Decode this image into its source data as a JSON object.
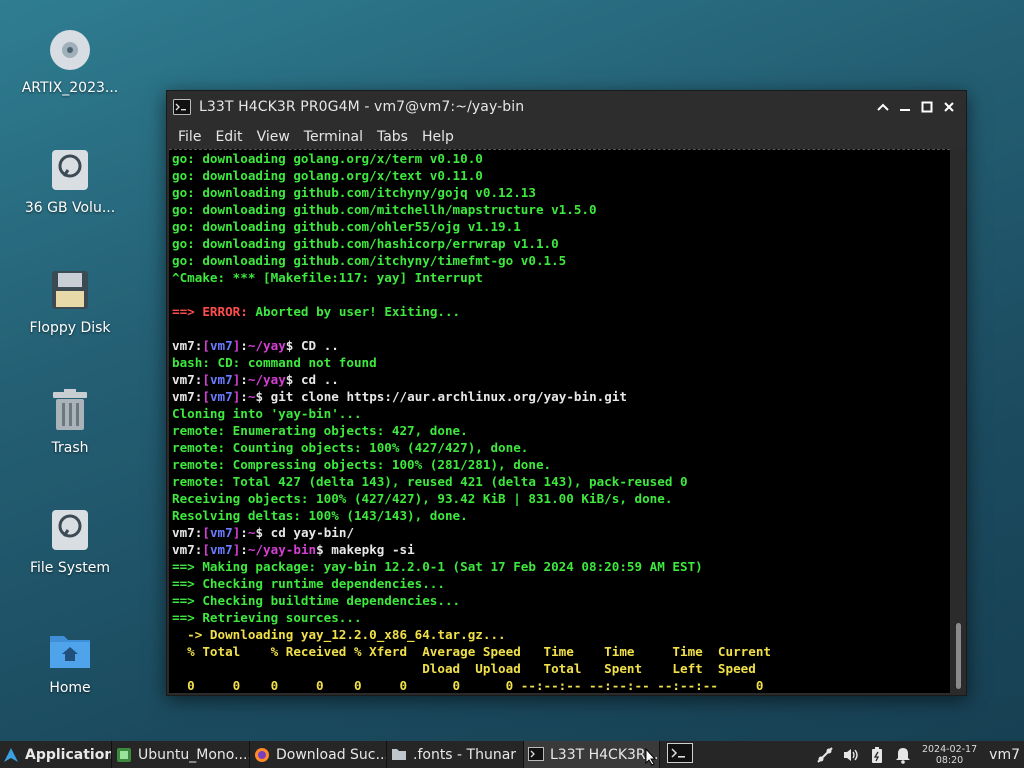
{
  "desktop": {
    "icons": [
      {
        "label": "ARTIX_2023...",
        "icon": "optical-disc-icon"
      },
      {
        "label": "36 GB Volu...",
        "icon": "hard-drive-icon"
      },
      {
        "label": "Floppy Disk",
        "icon": "floppy-disk-icon"
      },
      {
        "label": "Trash",
        "icon": "trash-icon"
      },
      {
        "label": "File System",
        "icon": "hard-drive-icon"
      },
      {
        "label": "Home",
        "icon": "home-folder-icon"
      }
    ]
  },
  "terminal": {
    "title": "L33T H4CK3R PR0G4M - vm7@vm7:~/yay-bin",
    "menu": [
      "File",
      "Edit",
      "View",
      "Terminal",
      "Tabs",
      "Help"
    ],
    "lines": {
      "l0": "go: downloading golang.org/x/term v0.10.0",
      "l1": "go: downloading golang.org/x/text v0.11.0",
      "l2": "go: downloading github.com/itchyny/gojq v0.12.13",
      "l3": "go: downloading github.com/mitchellh/mapstructure v1.5.0",
      "l4": "go: downloading github.com/ohler55/ojg v1.19.1",
      "l5": "go: downloading github.com/hashicorp/errwrap v1.1.0",
      "l6": "go: downloading github.com/itchyny/timefmt-go v0.1.5",
      "l7": "^Cmake: *** [Makefile:117: yay] Interrupt",
      "l9_arrow": "==> ",
      "l9_error": "ERROR:",
      "l9_rest": " Aborted by user! Exiting...",
      "prompt_user": "vm7",
      "prompt_host": "vm7",
      "l11_path": "~/yay",
      "l11_cmd": " CD ..",
      "l12": "bash: CD: command not found",
      "l13_path": "~/yay",
      "l13_cmd": " cd ..",
      "l14_path": "~",
      "l14_cmd": " git clone https://aur.archlinux.org/yay-bin.git",
      "l15": "Cloning into 'yay-bin'...",
      "l16": "remote: Enumerating objects: 427, done.",
      "l17": "remote: Counting objects: 100% (427/427), done.",
      "l18": "remote: Compressing objects: 100% (281/281), done.",
      "l19": "remote: Total 427 (delta 143), reused 421 (delta 143), pack-reused 0",
      "l20": "Receiving objects: 100% (427/427), 93.42 KiB | 831.00 KiB/s, done.",
      "l21": "Resolving deltas: 100% (143/143), done.",
      "l22_path": "~",
      "l22_cmd": " cd yay-bin/",
      "l23_path": "~/yay-bin",
      "l23_cmd": " makepkg -si",
      "l24": "==> Making package: yay-bin 12.2.0-1 (Sat 17 Feb 2024 08:20:59 AM EST)",
      "l25": "==> Checking runtime dependencies...",
      "l26": "==> Checking buildtime dependencies...",
      "l27": "==> Retrieving sources...",
      "l28": "  -> Downloading yay_12.2.0_x86_64.tar.gz...",
      "l29": "  % Total    % Received % Xferd  Average Speed   Time    Time     Time  Current",
      "l30": "                                 Dload  Upload   Total   Spent    Left  Speed",
      "l31": "  0     0    0     0    0     0      0      0 --:--:-- --:--:-- --:--:--     0"
    }
  },
  "taskbar": {
    "applications": "Applications",
    "tasks": [
      {
        "label": "Ubuntu_Mono....",
        "icon": "font-manager-icon"
      },
      {
        "label": "Download Suc...",
        "icon": "firefox-icon"
      },
      {
        "label": ".fonts - Thunar",
        "icon": "folder-icon"
      },
      {
        "label": "L33T H4CK3R...",
        "icon": "terminal-icon"
      }
    ],
    "clock_date": "2024-02-17",
    "clock_time": "08:20",
    "user": "vm7"
  }
}
